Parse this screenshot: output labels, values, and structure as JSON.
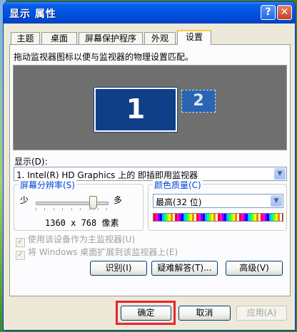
{
  "window": {
    "title": "显示 属性",
    "help_label": "?",
    "close_label": "✕"
  },
  "tabs": [
    {
      "label": "主题"
    },
    {
      "label": "桌面"
    },
    {
      "label": "屏幕保护程序"
    },
    {
      "label": "外观"
    },
    {
      "label": "设置"
    }
  ],
  "active_tab": "设置",
  "settings": {
    "instruction": "拖动监视器图标以便与监视器的物理设置匹配。",
    "monitors": [
      {
        "label": "1"
      },
      {
        "label": "2"
      }
    ],
    "display_label": "显示(D):",
    "display_value": "1. Intel(R) HD Graphics 上的 即插即用监视器",
    "resolution": {
      "title": "屏幕分辨率(S)",
      "less_label": "少",
      "more_label": "多",
      "value": "1360 x 768 像素",
      "slider_level": 0.92
    },
    "color_quality": {
      "title": "颜色质量(C)",
      "value": "最高(32 位)"
    },
    "checkbox_primary": {
      "label": "使用该设备作为主监视器(U)",
      "checked": true,
      "enabled": false
    },
    "checkbox_extend": {
      "label": "将 Windows 桌面扩展到该监视器上(E)",
      "checked": true,
      "enabled": false
    },
    "buttons": {
      "identify": "识别(I)",
      "troubleshoot": "疑难解答(T)...",
      "advanced": "高级(V)"
    }
  },
  "footer": {
    "ok": "确定",
    "cancel": "取消",
    "apply": "应用(A)"
  },
  "colors": {
    "title_bar": "#0054e3",
    "highlight_box": "#e8252d",
    "monitor_primary": "#0f3f86"
  }
}
